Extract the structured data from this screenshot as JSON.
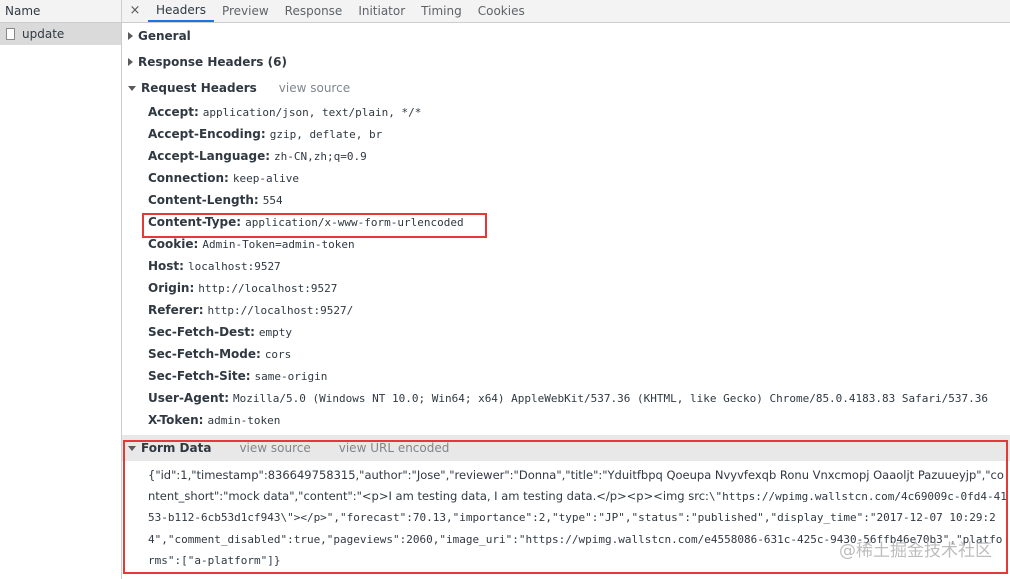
{
  "left": {
    "header": "Name",
    "request_name": "update"
  },
  "tabs": [
    "Headers",
    "Preview",
    "Response",
    "Initiator",
    "Timing",
    "Cookies"
  ],
  "close_glyph": "×",
  "sections": {
    "general": "General",
    "response_headers": "Response Headers (6)",
    "request_headers": "Request Headers",
    "view_source": "view source"
  },
  "request_headers": [
    {
      "k": "Accept:",
      "v": "application/json, text/plain, */*"
    },
    {
      "k": "Accept-Encoding:",
      "v": "gzip, deflate, br"
    },
    {
      "k": "Accept-Language:",
      "v": "zh-CN,zh;q=0.9"
    },
    {
      "k": "Connection:",
      "v": "keep-alive"
    },
    {
      "k": "Content-Length:",
      "v": "554"
    },
    {
      "k": "Content-Type:",
      "v": "application/x-www-form-urlencoded"
    },
    {
      "k": "Cookie:",
      "v": "Admin-Token=admin-token"
    },
    {
      "k": "Host:",
      "v": "localhost:9527"
    },
    {
      "k": "Origin:",
      "v": "http://localhost:9527"
    },
    {
      "k": "Referer:",
      "v": "http://localhost:9527/"
    },
    {
      "k": "Sec-Fetch-Dest:",
      "v": "empty"
    },
    {
      "k": "Sec-Fetch-Mode:",
      "v": "cors"
    },
    {
      "k": "Sec-Fetch-Site:",
      "v": "same-origin"
    },
    {
      "k": "User-Agent:",
      "v": "Mozilla/5.0 (Windows NT 10.0; Win64; x64) AppleWebKit/537.36 (KHTML, like Gecko) Chrome/85.0.4183.83 Safari/537.36"
    },
    {
      "k": "X-Token:",
      "v": "admin-token"
    }
  ],
  "form_data": {
    "title": "Form Data",
    "view_source": "view source",
    "view_url_encoded": "view URL encoded",
    "text_part1": "{\"id\":1,\"timestamp\":836649758315,\"author\":\"Jose\",\"reviewer\":\"Donna\",\"title\":\"Yduitfbpq Qoeupa Nvyvfexqb Ronu Vnxcmopj Oaaoljt Pazuueyjp\",\"content_short\":\"mock data\",\"content\":\"<p>I am testing data, I am testing data.</p><p><img src:",
    "text_part2": "\\\"https://wpimg.wallstcn.com/4c69009c-0fd4-4153-b112-6cb53d1cf943\\\"></p>\",\"forecast\":70.13,\"importance\":2,\"type\":\"JP\",\"status\":\"published\",\"display_time\":\"2017-12-07 10:29:24\",\"comment_disabled\":true,\"pageviews\":2060,\"image_uri\":\"https://wpimg.wallstcn.com/e4558086-631c-425c-9430-56ffb46e70b3\",\"platforms\":[\"a-platform\"]}"
  },
  "watermark": "@稀土掘金技术社区",
  "colors": {
    "highlight": "#e53935",
    "active_tab": "#1a73e8"
  }
}
